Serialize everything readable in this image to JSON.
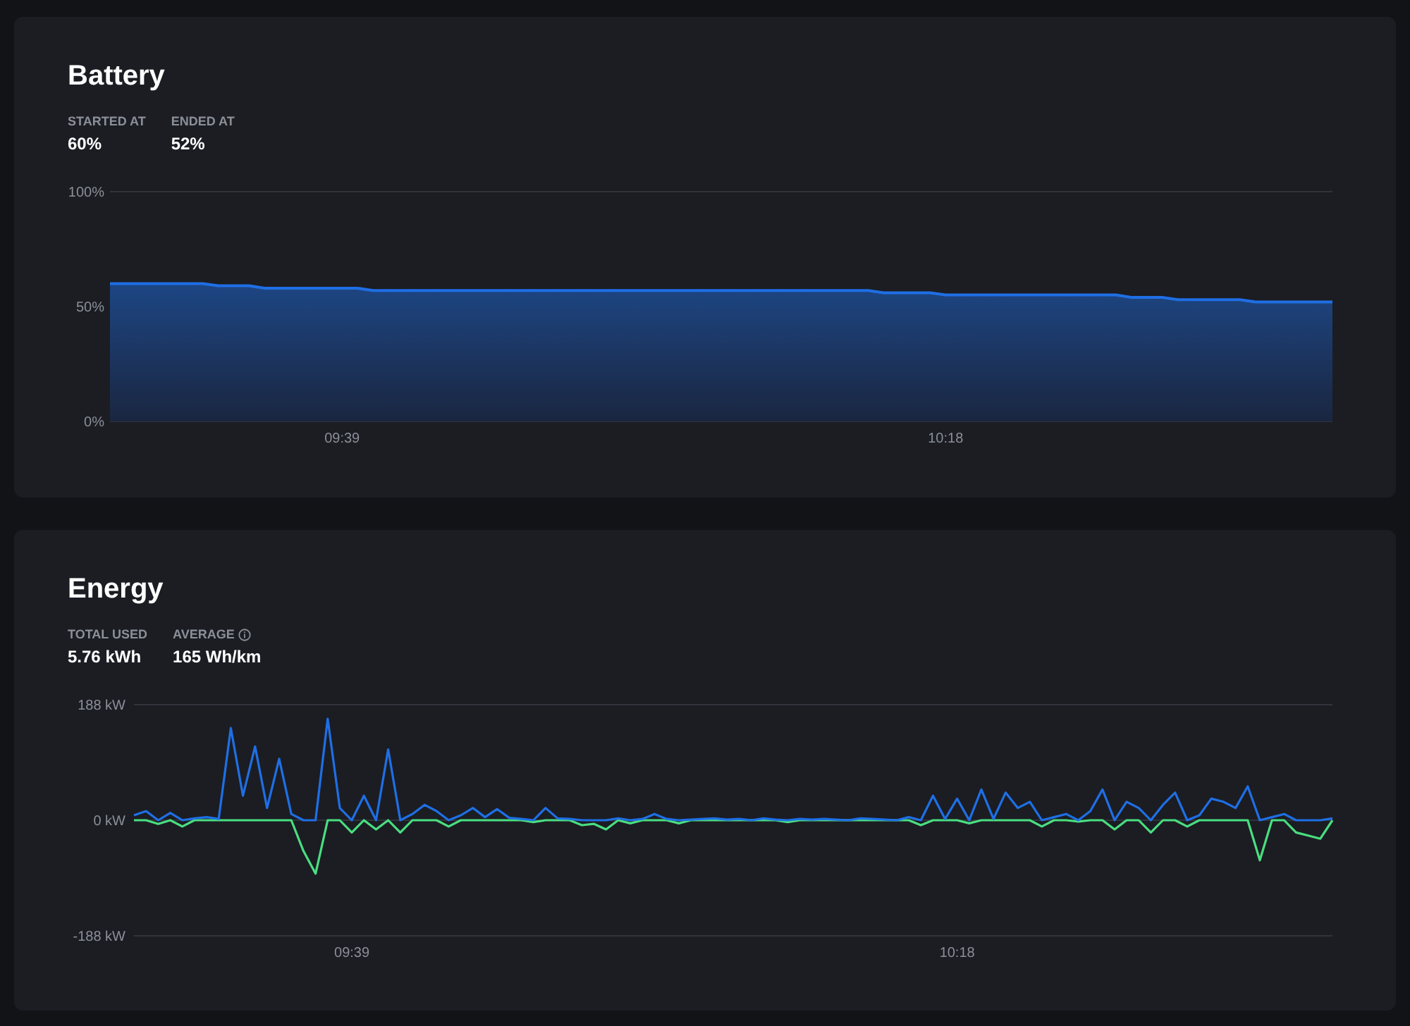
{
  "cards": [
    {
      "title": "Battery",
      "stats": [
        {
          "label": "STARTED AT",
          "value": "60%"
        },
        {
          "label": "ENDED AT",
          "value": "52%"
        }
      ],
      "chart_data": {
        "type": "area",
        "ylim": [
          0,
          100
        ],
        "yticks": [
          {
            "value": 0,
            "label": "0%"
          },
          {
            "value": 50,
            "label": "50%"
          },
          {
            "value": 100,
            "label": "100%"
          }
        ],
        "categories": [
          null,
          null,
          null,
          null,
          null,
          null,
          null,
          null,
          null,
          null,
          null,
          null,
          null,
          null,
          null,
          "09:39",
          null,
          null,
          null,
          null,
          null,
          null,
          null,
          null,
          null,
          null,
          null,
          null,
          null,
          null,
          null,
          null,
          null,
          null,
          null,
          null,
          null,
          null,
          null,
          null,
          null,
          null,
          null,
          null,
          null,
          null,
          null,
          null,
          null,
          null,
          null,
          null,
          null,
          null,
          "10:18",
          null,
          null,
          null,
          null,
          null,
          null,
          null,
          null,
          null,
          null,
          null,
          null,
          null,
          null,
          null,
          null,
          null,
          null,
          null,
          null,
          null,
          null,
          null,
          null,
          null
        ],
        "series": [
          {
            "color": "#1f6fe5",
            "values": [
              60,
              60,
              60,
              60,
              60,
              60,
              60,
              59,
              59,
              59,
              58,
              58,
              58,
              58,
              58,
              58,
              58,
              57,
              57,
              57,
              57,
              57,
              57,
              57,
              57,
              57,
              57,
              57,
              57,
              57,
              57,
              57,
              57,
              57,
              57,
              57,
              57,
              57,
              57,
              57,
              57,
              57,
              57,
              57,
              57,
              57,
              57,
              57,
              57,
              57,
              56,
              56,
              56,
              56,
              55,
              55,
              55,
              55,
              55,
              55,
              55,
              55,
              55,
              55,
              55,
              55,
              54,
              54,
              54,
              53,
              53,
              53,
              53,
              53,
              52,
              52,
              52,
              52,
              52,
              52
            ]
          }
        ]
      }
    },
    {
      "title": "Energy",
      "stats": [
        {
          "label": "TOTAL USED",
          "value": "5.76 kWh",
          "info": false
        },
        {
          "label": "AVERAGE",
          "value": "165 Wh/km",
          "info": true
        }
      ],
      "chart_data": {
        "type": "line",
        "ylim": [
          -188,
          188
        ],
        "yticks": [
          {
            "value": -188,
            "label": "-188 kW"
          },
          {
            "value": 0,
            "label": "0 kW"
          },
          {
            "value": 188,
            "label": "188 kW"
          }
        ],
        "categories": [
          null,
          null,
          null,
          null,
          null,
          null,
          null,
          null,
          null,
          null,
          null,
          null,
          null,
          null,
          null,
          null,
          null,
          null,
          "09:39",
          null,
          null,
          null,
          null,
          null,
          null,
          null,
          null,
          null,
          null,
          null,
          null,
          null,
          null,
          null,
          null,
          null,
          null,
          null,
          null,
          null,
          null,
          null,
          null,
          null,
          null,
          null,
          null,
          null,
          null,
          null,
          null,
          null,
          null,
          null,
          null,
          null,
          null,
          null,
          null,
          null,
          null,
          null,
          null,
          null,
          null,
          null,
          null,
          null,
          "10:18",
          null,
          null,
          null,
          null,
          null,
          null,
          null,
          null,
          null,
          null,
          null,
          null,
          null,
          null,
          null,
          null,
          null,
          null,
          null,
          null,
          null,
          null,
          null,
          null,
          null,
          null,
          null,
          null,
          null,
          null,
          null
        ],
        "series": [
          {
            "color": "#1f6fe5",
            "values": [
              8,
              15,
              0,
              12,
              0,
              3,
              5,
              2,
              150,
              40,
              120,
              20,
              100,
              10,
              0,
              0,
              165,
              20,
              0,
              40,
              0,
              115,
              0,
              10,
              25,
              15,
              0,
              8,
              20,
              5,
              18,
              4,
              2,
              0,
              20,
              3,
              2,
              0,
              0,
              0,
              3,
              0,
              2,
              10,
              2,
              0,
              1,
              2,
              3,
              1,
              2,
              0,
              3,
              1,
              0,
              2,
              1,
              2,
              1,
              0,
              3,
              2,
              1,
              0,
              5,
              0,
              40,
              2,
              35,
              0,
              50,
              2,
              45,
              20,
              30,
              0,
              5,
              10,
              0,
              15,
              50,
              0,
              30,
              20,
              0,
              25,
              45,
              0,
              8,
              35,
              30,
              20,
              55,
              0,
              5,
              10,
              0,
              0,
              0,
              3
            ]
          },
          {
            "color": "#4ade80",
            "values": [
              0,
              0,
              -6,
              0,
              -10,
              0,
              0,
              0,
              0,
              0,
              0,
              0,
              0,
              0,
              -50,
              -87,
              0,
              0,
              -20,
              0,
              -15,
              0,
              -20,
              0,
              0,
              0,
              -10,
              0,
              0,
              0,
              0,
              0,
              0,
              -3,
              0,
              0,
              0,
              -8,
              -6,
              -15,
              0,
              -5,
              0,
              0,
              0,
              -5,
              0,
              0,
              0,
              0,
              0,
              0,
              0,
              0,
              -3,
              0,
              0,
              0,
              0,
              0,
              0,
              0,
              0,
              0,
              0,
              -8,
              0,
              0,
              0,
              -5,
              0,
              0,
              0,
              0,
              0,
              -10,
              0,
              0,
              -2,
              0,
              0,
              -15,
              0,
              0,
              -20,
              0,
              0,
              -10,
              0,
              0,
              0,
              0,
              0,
              -65,
              0,
              0,
              -20,
              -25,
              -30,
              0
            ]
          }
        ]
      }
    }
  ]
}
